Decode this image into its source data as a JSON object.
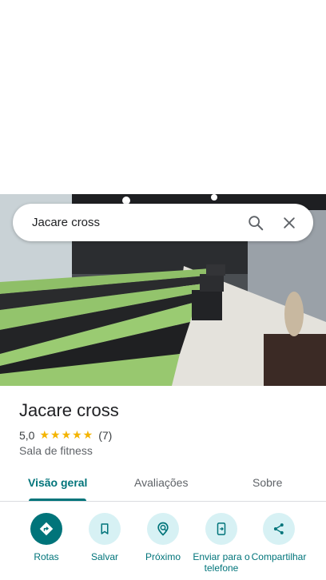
{
  "search": {
    "query": "Jacare cross"
  },
  "place": {
    "name": "Jacare cross",
    "rating": "5,0",
    "stars": "★★★★★",
    "review_count": "(7)",
    "category": "Sala de fitness"
  },
  "tabs": [
    {
      "label": "Visão geral",
      "active": true
    },
    {
      "label": "Avaliações",
      "active": false
    },
    {
      "label": "Sobre",
      "active": false
    }
  ],
  "actions": [
    {
      "label": "Rotas",
      "icon": "directions-icon"
    },
    {
      "label": "Salvar",
      "icon": "bookmark-icon"
    },
    {
      "label": "Próximo",
      "icon": "nearby-icon"
    },
    {
      "label": "Enviar para o telefone",
      "icon": "send-to-phone-icon"
    },
    {
      "label": "Compartilhar",
      "icon": "share-icon"
    }
  ],
  "colors": {
    "accent": "#00747a",
    "action_bg": "#d7f1f4",
    "star": "#f4b400"
  }
}
